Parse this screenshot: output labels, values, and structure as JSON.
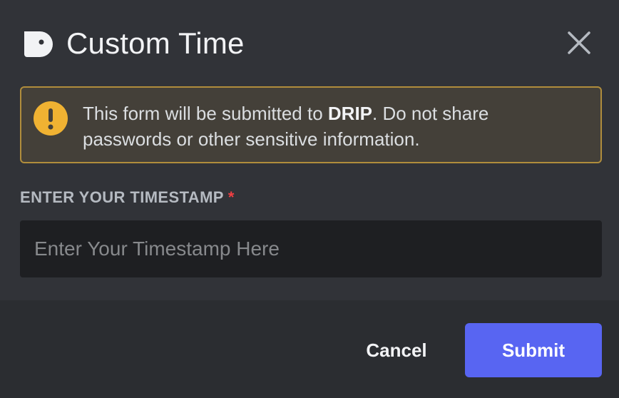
{
  "modal": {
    "title": "Custom Time",
    "app_icon": "drip-logo-icon",
    "close_icon": "close-icon"
  },
  "notice": {
    "icon": "warning-icon",
    "text_before": "This form will be submitted to ",
    "app_name": "DRIP",
    "text_after": ". Do not share passwords or other sensitive information."
  },
  "field": {
    "label": "ENTER YOUR TIMESTAMP",
    "required_marker": "*",
    "value": "",
    "placeholder": "Enter Your Timestamp Here"
  },
  "footer": {
    "cancel_label": "Cancel",
    "submit_label": "Submit"
  },
  "colors": {
    "background": "#313338",
    "footer": "#2b2d31",
    "input": "#1e1f22",
    "warning_border": "#b08d3c",
    "warning_fill": "#444039",
    "warning_icon": "#f0b232",
    "accent": "#5865f2",
    "required": "#f23f43"
  }
}
